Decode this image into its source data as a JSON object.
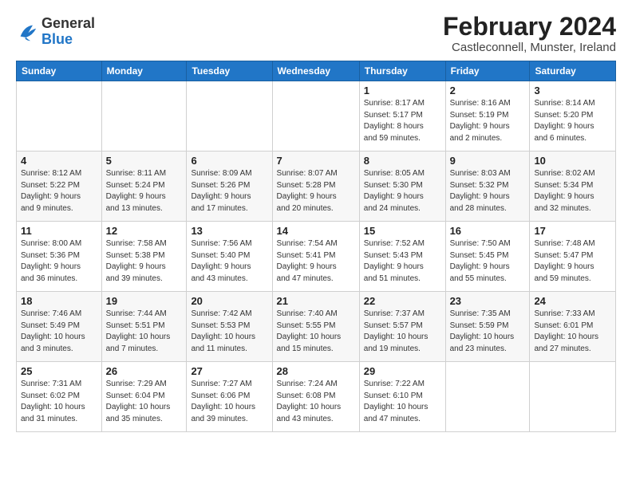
{
  "header": {
    "logo_general": "General",
    "logo_blue": "Blue",
    "month_title": "February 2024",
    "location": "Castleconnell, Munster, Ireland"
  },
  "weekdays": [
    "Sunday",
    "Monday",
    "Tuesday",
    "Wednesday",
    "Thursday",
    "Friday",
    "Saturday"
  ],
  "weeks": [
    [
      {
        "day": "",
        "info": ""
      },
      {
        "day": "",
        "info": ""
      },
      {
        "day": "",
        "info": ""
      },
      {
        "day": "",
        "info": ""
      },
      {
        "day": "1",
        "info": "Sunrise: 8:17 AM\nSunset: 5:17 PM\nDaylight: 8 hours\nand 59 minutes."
      },
      {
        "day": "2",
        "info": "Sunrise: 8:16 AM\nSunset: 5:19 PM\nDaylight: 9 hours\nand 2 minutes."
      },
      {
        "day": "3",
        "info": "Sunrise: 8:14 AM\nSunset: 5:20 PM\nDaylight: 9 hours\nand 6 minutes."
      }
    ],
    [
      {
        "day": "4",
        "info": "Sunrise: 8:12 AM\nSunset: 5:22 PM\nDaylight: 9 hours\nand 9 minutes."
      },
      {
        "day": "5",
        "info": "Sunrise: 8:11 AM\nSunset: 5:24 PM\nDaylight: 9 hours\nand 13 minutes."
      },
      {
        "day": "6",
        "info": "Sunrise: 8:09 AM\nSunset: 5:26 PM\nDaylight: 9 hours\nand 17 minutes."
      },
      {
        "day": "7",
        "info": "Sunrise: 8:07 AM\nSunset: 5:28 PM\nDaylight: 9 hours\nand 20 minutes."
      },
      {
        "day": "8",
        "info": "Sunrise: 8:05 AM\nSunset: 5:30 PM\nDaylight: 9 hours\nand 24 minutes."
      },
      {
        "day": "9",
        "info": "Sunrise: 8:03 AM\nSunset: 5:32 PM\nDaylight: 9 hours\nand 28 minutes."
      },
      {
        "day": "10",
        "info": "Sunrise: 8:02 AM\nSunset: 5:34 PM\nDaylight: 9 hours\nand 32 minutes."
      }
    ],
    [
      {
        "day": "11",
        "info": "Sunrise: 8:00 AM\nSunset: 5:36 PM\nDaylight: 9 hours\nand 36 minutes."
      },
      {
        "day": "12",
        "info": "Sunrise: 7:58 AM\nSunset: 5:38 PM\nDaylight: 9 hours\nand 39 minutes."
      },
      {
        "day": "13",
        "info": "Sunrise: 7:56 AM\nSunset: 5:40 PM\nDaylight: 9 hours\nand 43 minutes."
      },
      {
        "day": "14",
        "info": "Sunrise: 7:54 AM\nSunset: 5:41 PM\nDaylight: 9 hours\nand 47 minutes."
      },
      {
        "day": "15",
        "info": "Sunrise: 7:52 AM\nSunset: 5:43 PM\nDaylight: 9 hours\nand 51 minutes."
      },
      {
        "day": "16",
        "info": "Sunrise: 7:50 AM\nSunset: 5:45 PM\nDaylight: 9 hours\nand 55 minutes."
      },
      {
        "day": "17",
        "info": "Sunrise: 7:48 AM\nSunset: 5:47 PM\nDaylight: 9 hours\nand 59 minutes."
      }
    ],
    [
      {
        "day": "18",
        "info": "Sunrise: 7:46 AM\nSunset: 5:49 PM\nDaylight: 10 hours\nand 3 minutes."
      },
      {
        "day": "19",
        "info": "Sunrise: 7:44 AM\nSunset: 5:51 PM\nDaylight: 10 hours\nand 7 minutes."
      },
      {
        "day": "20",
        "info": "Sunrise: 7:42 AM\nSunset: 5:53 PM\nDaylight: 10 hours\nand 11 minutes."
      },
      {
        "day": "21",
        "info": "Sunrise: 7:40 AM\nSunset: 5:55 PM\nDaylight: 10 hours\nand 15 minutes."
      },
      {
        "day": "22",
        "info": "Sunrise: 7:37 AM\nSunset: 5:57 PM\nDaylight: 10 hours\nand 19 minutes."
      },
      {
        "day": "23",
        "info": "Sunrise: 7:35 AM\nSunset: 5:59 PM\nDaylight: 10 hours\nand 23 minutes."
      },
      {
        "day": "24",
        "info": "Sunrise: 7:33 AM\nSunset: 6:01 PM\nDaylight: 10 hours\nand 27 minutes."
      }
    ],
    [
      {
        "day": "25",
        "info": "Sunrise: 7:31 AM\nSunset: 6:02 PM\nDaylight: 10 hours\nand 31 minutes."
      },
      {
        "day": "26",
        "info": "Sunrise: 7:29 AM\nSunset: 6:04 PM\nDaylight: 10 hours\nand 35 minutes."
      },
      {
        "day": "27",
        "info": "Sunrise: 7:27 AM\nSunset: 6:06 PM\nDaylight: 10 hours\nand 39 minutes."
      },
      {
        "day": "28",
        "info": "Sunrise: 7:24 AM\nSunset: 6:08 PM\nDaylight: 10 hours\nand 43 minutes."
      },
      {
        "day": "29",
        "info": "Sunrise: 7:22 AM\nSunset: 6:10 PM\nDaylight: 10 hours\nand 47 minutes."
      },
      {
        "day": "",
        "info": ""
      },
      {
        "day": "",
        "info": ""
      }
    ]
  ]
}
